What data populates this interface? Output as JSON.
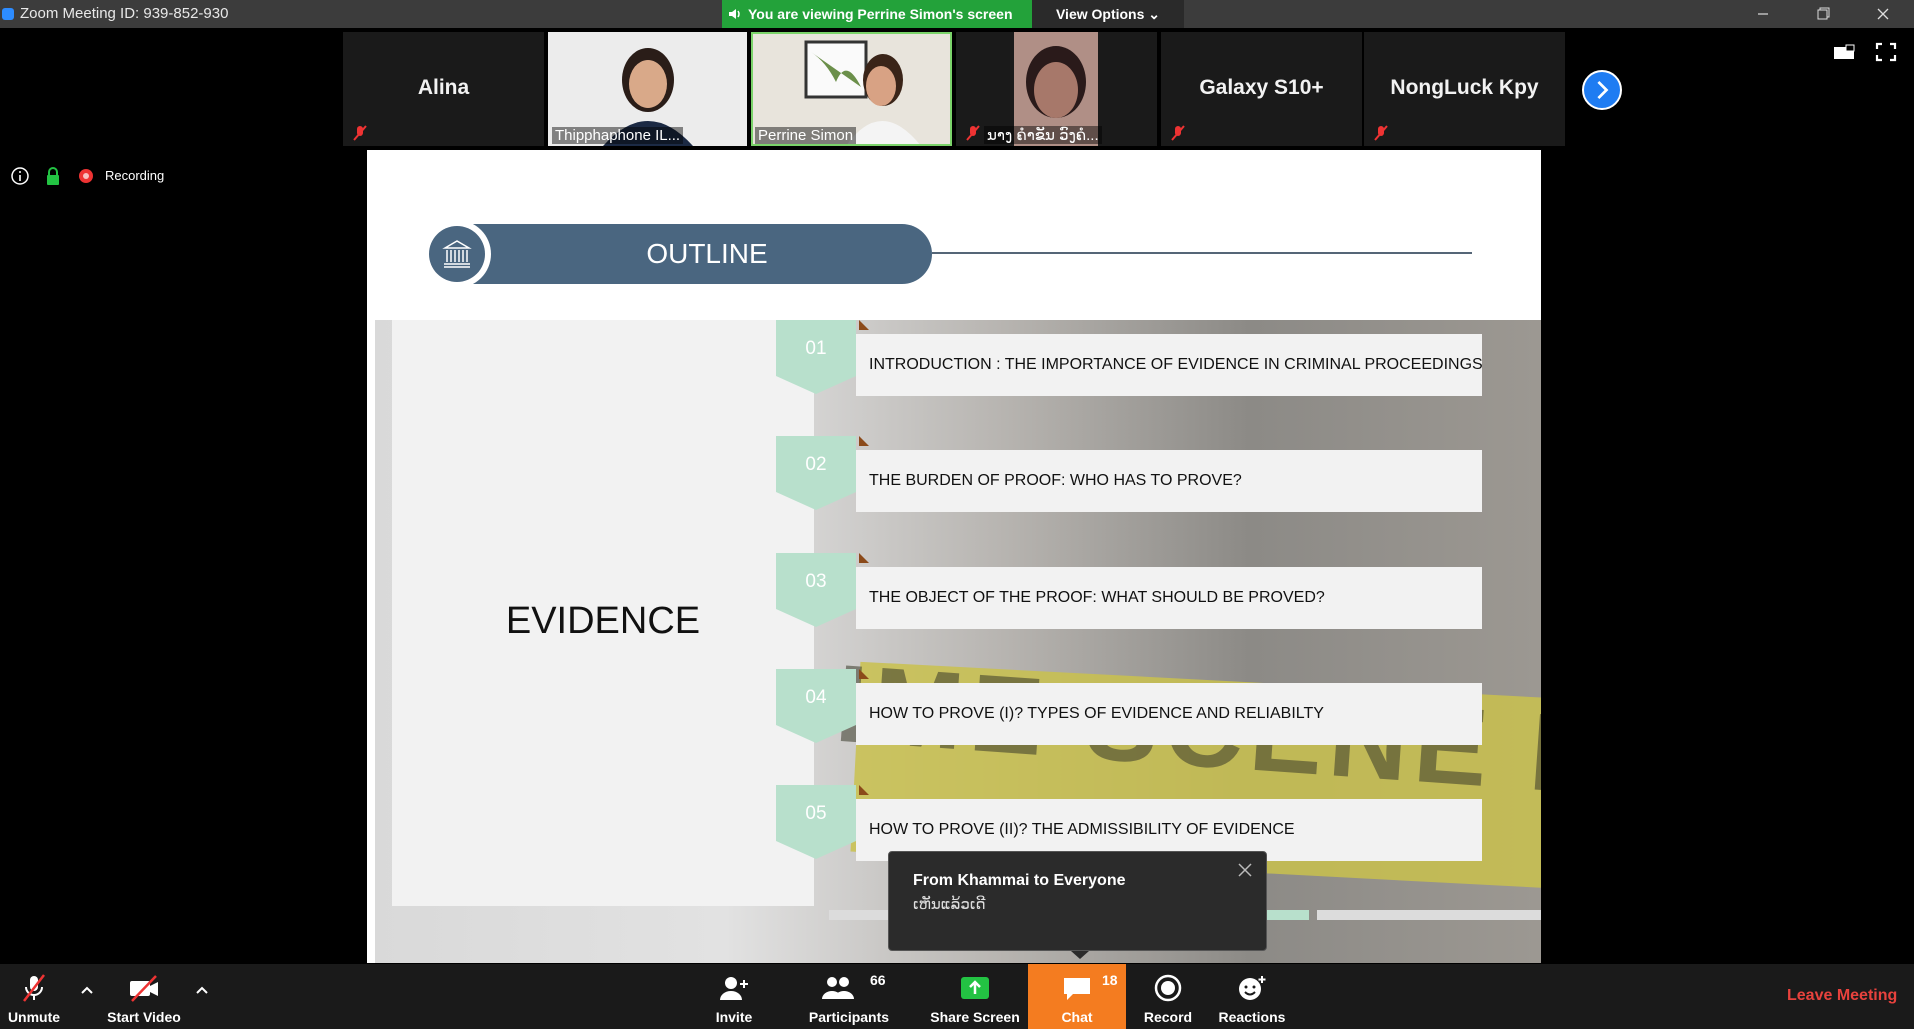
{
  "window": {
    "title": "Zoom Meeting ID: 939-852-930",
    "banner_text": "You are viewing Perrine Simon's screen",
    "view_options_label": "View Options",
    "accent_green": "#23a23a"
  },
  "gallery": {
    "tiles": [
      {
        "name": "Alina",
        "muted": true,
        "video": false
      },
      {
        "name": "Thipphaphone IL...",
        "muted": false,
        "video": true
      },
      {
        "name": "Perrine Simon",
        "muted": false,
        "video": true,
        "active_speaker": true
      },
      {
        "name": "ນາງ ຄໍາຂັນ ວົງຄໍ...",
        "muted": true,
        "video": true
      },
      {
        "name": "Galaxy S10+",
        "muted": true,
        "video": false
      },
      {
        "name": "NongLuck Kpy",
        "muted": true,
        "video": false
      }
    ]
  },
  "status": {
    "recording_label": "Recording"
  },
  "slide": {
    "header": "OUTLINE",
    "section_title": "EVIDENCE",
    "items": [
      {
        "num": "01",
        "text": "INTRODUCTION : THE IMPORTANCE OF EVIDENCE IN CRIMINAL PROCEEDINGS"
      },
      {
        "num": "02",
        "text": "THE BURDEN OF PROOF: WHO HAS TO PROVE?"
      },
      {
        "num": "03",
        "text": "THE OBJECT OF THE PROOF: WHAT SHOULD BE PROVED?"
      },
      {
        "num": "04",
        "text": "HOW TO PROVE (I)? TYPES OF EVIDENCE AND RELIABILTY"
      },
      {
        "num": "05",
        "text": "HOW TO PROVE (II)? THE ADMISSIBILITY OF EVIDENCE"
      }
    ],
    "background_text": "IME SCENE DO"
  },
  "chat_toast": {
    "title": "From Khammai to Everyone",
    "message": "ເຫັນແລ້ວເດີ"
  },
  "toolbar": {
    "unmute": "Unmute",
    "start_video": "Start Video",
    "invite": "Invite",
    "participants": "Participants",
    "participants_count": "66",
    "share_screen": "Share Screen",
    "chat": "Chat",
    "chat_count": "18",
    "record": "Record",
    "reactions": "Reactions",
    "leave": "Leave Meeting",
    "chat_color": "#f47c20",
    "leave_color": "#e8423d"
  }
}
